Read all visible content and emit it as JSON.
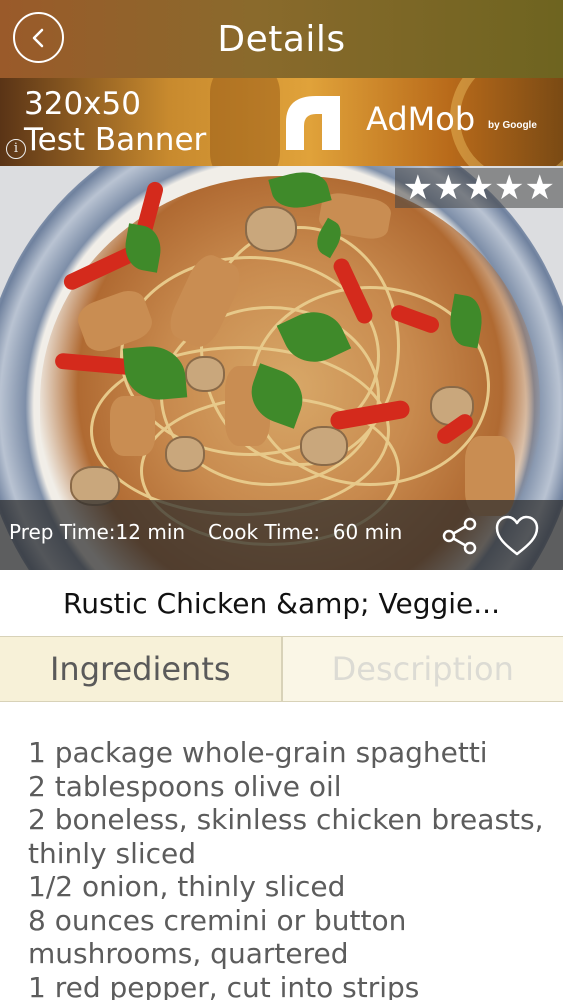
{
  "header": {
    "title": "Details",
    "back_icon": "chevron-left-icon"
  },
  "ad": {
    "line1": "320x50",
    "line2": "Test Banner",
    "brand": "AdMob",
    "brand_suffix": "by Google",
    "info_glyph": "i"
  },
  "photo": {
    "rating_stars": 4.5,
    "rating_display": "★★★★★",
    "prep_time": "Prep Time:12 min",
    "cook_time": "Cook Time:  60 min",
    "share_icon": "share-icon",
    "favorite_icon": "heart-outline-icon"
  },
  "recipe": {
    "title": "Rustic Chicken &amp; Veggie..."
  },
  "tabs": [
    {
      "label": "Ingredients",
      "active": true
    },
    {
      "label": "Description",
      "active": false
    }
  ],
  "ingredients": [
    "1 package whole-grain spaghetti",
    "2 tablespoons olive oil",
    "2 boneless, skinless chicken breasts,",
    "thinly sliced",
    "1/2 onion, thinly sliced",
    "8 ounces cremini or button",
    "mushrooms, quartered",
    "1 red pepper, cut into strips"
  ],
  "colors": {
    "header_start": "#9a5a2a",
    "header_end": "#6e6420",
    "tab_active_bg": "#f7f1d8",
    "tab_inactive_text": "#dcdbd4",
    "ingredient_text": "#5c5c5c"
  }
}
